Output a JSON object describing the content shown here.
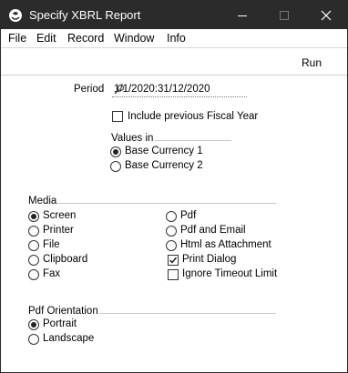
{
  "window": {
    "title": "Specify XBRL Report"
  },
  "menu": [
    "File",
    "Edit",
    "Record",
    "Window",
    "Info"
  ],
  "toolbar": {
    "run_label": "Run"
  },
  "period": {
    "label": "Period",
    "value": "1/1/2020:31/12/2020"
  },
  "include_previous": {
    "label": "Include previous Fiscal Year",
    "checked": false
  },
  "values_in": {
    "title": "Values in",
    "options": [
      {
        "label": "Base Currency 1",
        "selected": true
      },
      {
        "label": "Base Currency 2",
        "selected": false
      }
    ]
  },
  "media": {
    "title": "Media",
    "left": [
      {
        "label": "Screen",
        "selected": true
      },
      {
        "label": "Printer",
        "selected": false
      },
      {
        "label": "File",
        "selected": false
      },
      {
        "label": "Clipboard",
        "selected": false
      },
      {
        "label": "Fax",
        "selected": false
      }
    ],
    "right": [
      {
        "label": "Pdf",
        "selected": false
      },
      {
        "label": "Pdf and Email",
        "selected": false
      },
      {
        "label": "Html as Attachment",
        "selected": false
      }
    ],
    "print_dialog": {
      "label": "Print Dialog",
      "checked": true
    },
    "ignore_timeout": {
      "label": "Ignore Timeout Limit",
      "checked": false
    }
  },
  "pdf_orientation": {
    "title": "Pdf Orientation",
    "options": [
      {
        "label": "Portrait",
        "selected": true
      },
      {
        "label": "Landscape",
        "selected": false
      }
    ]
  }
}
